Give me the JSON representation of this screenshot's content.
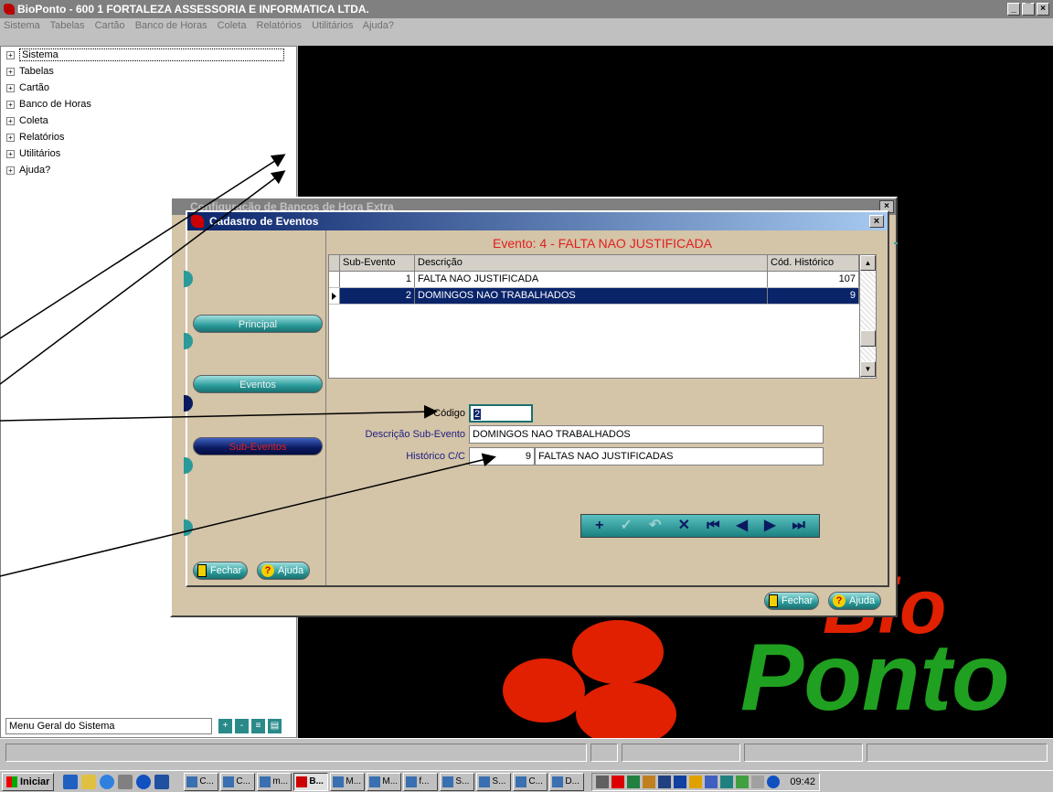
{
  "app": {
    "title": "BioPonto - 600 1 FORTALEZA ASSESSORIA E INFORMATICA LTDA.",
    "window_buttons": [
      "_",
      "̅",
      "×"
    ]
  },
  "menubar": [
    "Sistema",
    "Tabelas",
    "Cartão",
    "Banco de Horas",
    "Coleta",
    "Relatórios",
    "Utilitários",
    "Ajuda?"
  ],
  "tree": [
    {
      "label": "Sistema"
    },
    {
      "label": "Tabelas"
    },
    {
      "label": "Cartão"
    },
    {
      "label": "Banco de Horas"
    },
    {
      "label": "Coleta"
    },
    {
      "label": "Relatórios"
    },
    {
      "label": "Utilitários"
    },
    {
      "label": "Ajuda?"
    }
  ],
  "menu_geral": "Menu Geral do Sistema",
  "logo": {
    "bio": "Bio",
    "ponto": "Ponto"
  },
  "bg_dialog": {
    "title": "Configuração de Bancos de Hora Extra"
  },
  "dialog": {
    "title": "Cadastro de Eventos",
    "close": "×",
    "nav_pills": {
      "principal": "Principal",
      "eventos": "Eventos",
      "sub_eventos": "Sub-Eventos"
    },
    "evento_title": "Evento: 4 - FALTA NAO JUSTIFICADA",
    "grid": {
      "headers": [
        "Sub-Evento",
        "Descrição",
        "Cód. Histórico"
      ],
      "rows": [
        {
          "sub": "1",
          "desc": "FALTA NAO JUSTIFICADA",
          "cod": "107"
        },
        {
          "sub": "2",
          "desc": "DOMINGOS NAO TRABALHADOS",
          "cod": "9"
        }
      ]
    },
    "form": {
      "codigo_label": "Código",
      "codigo_value": "2",
      "descricao_label": "Descrição Sub-Evento",
      "descricao_value": "DOMINGOS NAO TRABALHADOS",
      "historico_label": "Histórico C/C",
      "historico_code": "9",
      "historico_desc": "FALTAS NAO JUSTIFICADAS"
    },
    "buttons": {
      "fechar": "Fechar",
      "ajuda": "Ajuda"
    }
  },
  "taskbar": {
    "start": "Iniciar",
    "tasks": [
      "C...",
      "C...",
      "m...",
      "B...",
      "M...",
      "M...",
      "f...",
      "S...",
      "S...",
      "C...",
      "D..."
    ],
    "clock": "09:42"
  },
  "colors": {
    "teal": "#2a9a9a",
    "navy": "#0a246a",
    "red": "#e02020",
    "dialog_bg": "#d4c4a8",
    "logo_green": "#20a020",
    "logo_red": "#e02000"
  }
}
